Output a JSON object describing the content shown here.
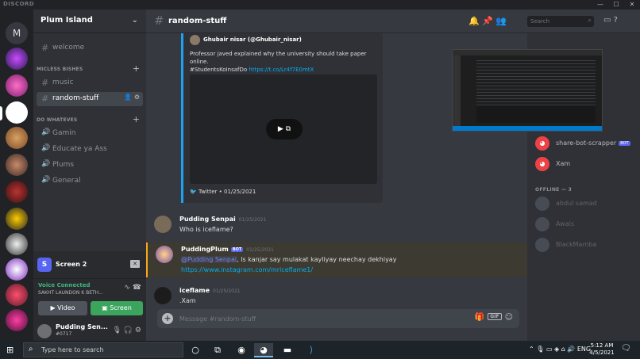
{
  "window": {
    "brand": "DISCORD"
  },
  "server": {
    "name": "Plum Island",
    "home_letter": "M"
  },
  "sidebar": {
    "channels_top": [
      {
        "label": "welcome"
      }
    ],
    "categories": [
      {
        "label": "MICLESS BISHES",
        "channels": [
          {
            "label": "music"
          },
          {
            "label": "random-stuff"
          }
        ]
      },
      {
        "label": "DO WHATEVES",
        "channels": [
          {
            "label": "Gamin"
          },
          {
            "label": "Educate ya Ass"
          },
          {
            "label": "Plums"
          },
          {
            "label": "General"
          }
        ]
      }
    ]
  },
  "screenshare": {
    "badge": "S",
    "label": "Screen 2"
  },
  "voice": {
    "status": "Voice Connected",
    "channel": "SAKHT LAUNDON K BETH...",
    "video_label": "Video",
    "screen_label": "Screen"
  },
  "user": {
    "name": "Pudding Sen...",
    "tag": "#0717"
  },
  "channel_header": {
    "name": "random-stuff"
  },
  "embed": {
    "author": "Ghubair nisar (@Ghubair_nisar)",
    "text_line1": "Professor javed explained why the university should take paper online.",
    "text_line2": "#StudentsKoInsafDo ",
    "link": "https://t.co/Lr4f7E0mtX",
    "footer": "Twitter • 01/25/2021"
  },
  "messages": [
    {
      "author": "Pudding Senpai",
      "time": "01/25/2021",
      "text": "Who is iceflame?"
    },
    {
      "author": "PuddingPlum",
      "bot": "BOT",
      "time": "01/25/2021",
      "mention": "@Pudding Senpai",
      "text": ", Is kanjar say mulakat kayliyay neechay dekhiyay",
      "link": "https://www.instagram.com/mriceflame1/"
    },
    {
      "author": "iceflame",
      "time": "01/25/2021",
      "text": ".Xam"
    }
  ],
  "composer": {
    "placeholder": "Message #random-stuff",
    "gif": "GIF"
  },
  "toolbar": {
    "search_placeholder": "Search"
  },
  "members": {
    "online": [
      {
        "name": "share-bot-scrapper",
        "bot": "BOT"
      },
      {
        "name": "Xam"
      }
    ],
    "offline_header": "OFFLINE — 3",
    "offline": [
      {
        "name": "abdul samad"
      },
      {
        "name": "Awais"
      },
      {
        "name": "BlackMamba"
      }
    ]
  },
  "taskbar": {
    "search_placeholder": "Type here to search",
    "time": "5:12 AM",
    "date": "4/5/2021"
  },
  "colors": {
    "accent": "#5865f2",
    "green": "#3ba55d",
    "twitter": "#1da1f2",
    "mention": "#faa61a"
  }
}
